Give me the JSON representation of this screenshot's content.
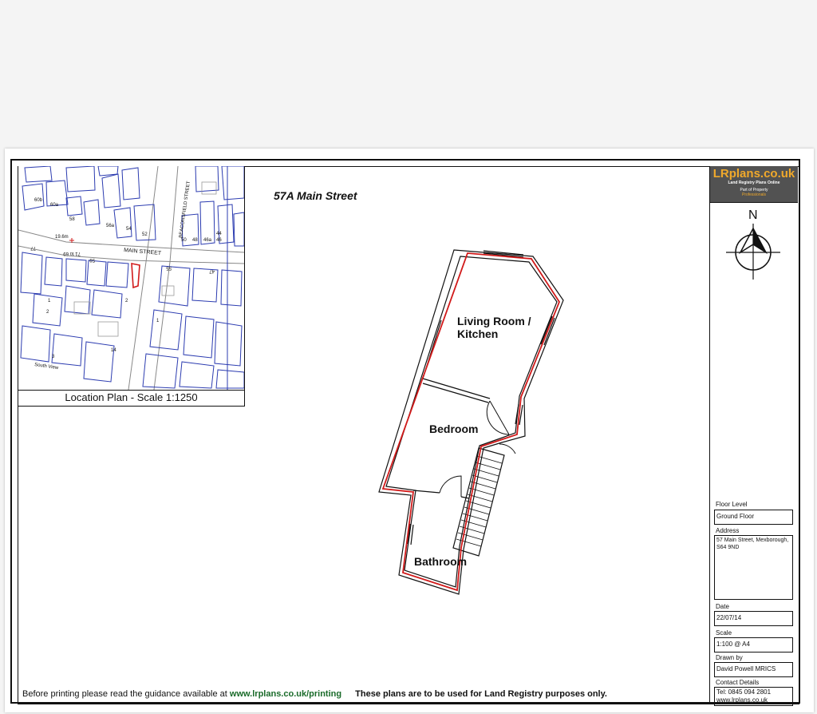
{
  "title": "57A Main Street",
  "location_plan": {
    "caption": "Location Plan - Scale 1:1250",
    "labels": {
      "beaconsfield": "BEACONSFIELD STREET",
      "main": "MAIN STREET",
      "south_view": "South View",
      "height": "19.6m",
      "n60b": "60b",
      "n60a": "60a",
      "n58": "58",
      "n56a": "56a",
      "n54": "54",
      "n52": "52",
      "n50": "50",
      "n48": "48",
      "n46a": "46a",
      "n46": "46",
      "n44": "44",
      "n77": "77",
      "n71to69": "71 to 69",
      "n59": "59",
      "n55": "55",
      "n47": "47",
      "n1": "1",
      "n2": "2",
      "n3": "3",
      "n14": "14",
      "n2b": "2",
      "n1b": "1"
    }
  },
  "rooms": {
    "living": "Living Room /",
    "living2": "Kitchen",
    "bedroom": "Bedroom",
    "bathroom": "Bathroom"
  },
  "logo": {
    "name": "LRplans.co.uk",
    "tagline": "Land Registry Plans Online",
    "part_of": "Part of Property",
    "part_of2": "Professionals"
  },
  "north_label": "N",
  "fields": {
    "floor_level_label": "Floor Level",
    "floor_level": "Ground Floor",
    "address_label": "Address",
    "address_line1": "57 Main Street, Mexborough,",
    "address_line2": "S64 9ND",
    "date_label": "Date",
    "date": "22/07/14",
    "scale_label": "Scale",
    "scale": "1:100 @ A4",
    "drawn_by_label": "Drawn by",
    "drawn_by": "David Powell MRICS",
    "contact_label": "Contact Details",
    "tel": "Tel: 0845 094 2801",
    "web": "www.lrplans.co.uk"
  },
  "footer": {
    "text1": "Before printing please read the guidance available at",
    "link": "www.lrplans.co.uk/printing",
    "notice": "These plans are to be used for Land Registry purposes only."
  },
  "colors": {
    "boundary": "#d11a1a",
    "map_lines": "#2b3bb0",
    "logo_bg": "#525252",
    "logo_accent": "#f0a92b"
  }
}
